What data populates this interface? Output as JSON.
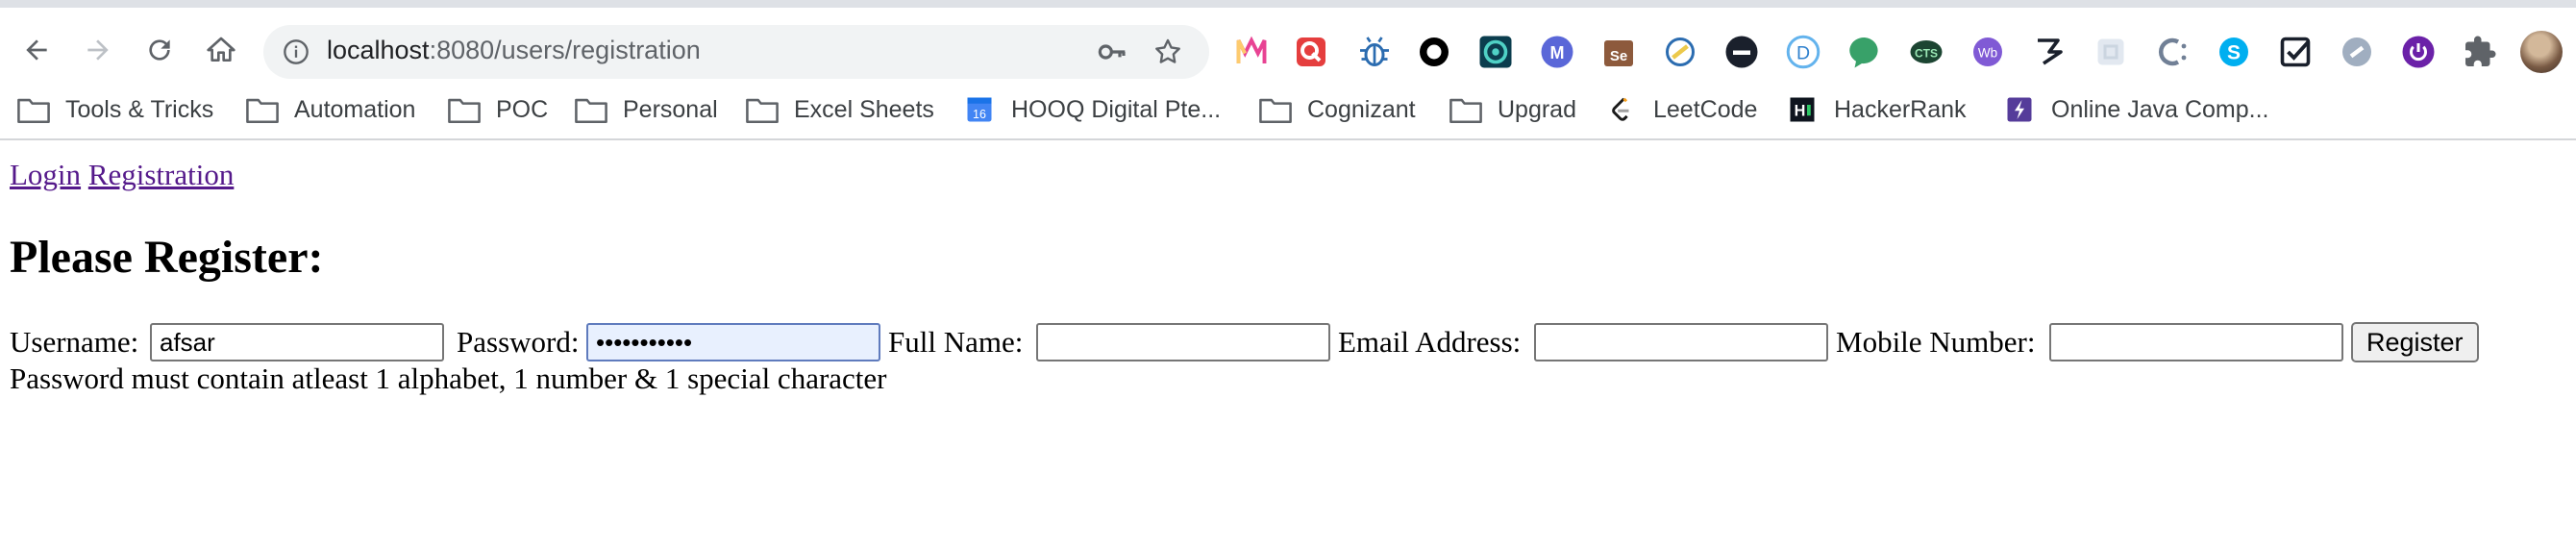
{
  "browser": {
    "url_host": "localhost",
    "url_rest": ":8080/users/registration",
    "extensions": [
      "m-icon",
      "quick-icon",
      "bug-icon",
      "circle-icon",
      "target-icon",
      "m-circle-icon",
      "selenium-icon",
      "chromium-icon",
      "minus-circle-icon",
      "d-icon",
      "chat-icon",
      "cts-icon",
      "wb-icon",
      "hook-icon",
      "tile-icon",
      "c-icon",
      "skype-icon",
      "check-icon",
      "link-icon",
      "power-icon",
      "puzzle-icon"
    ]
  },
  "bookmarks": [
    {
      "label": "Tools & Tricks",
      "icon": "folder-icon"
    },
    {
      "label": "Automation",
      "icon": "folder-icon"
    },
    {
      "label": "POC",
      "icon": "folder-icon"
    },
    {
      "label": "Personal",
      "icon": "folder-icon"
    },
    {
      "label": "Excel Sheets",
      "icon": "folder-icon"
    },
    {
      "label": "HOOQ Digital Pte...",
      "icon": "calendar-icon",
      "icon_text": "16"
    },
    {
      "label": "Cognizant",
      "icon": "folder-icon"
    },
    {
      "label": "Upgrad",
      "icon": "folder-icon"
    },
    {
      "label": "LeetCode",
      "icon": "leetcode-icon"
    },
    {
      "label": "HackerRank",
      "icon": "hackerrank-icon",
      "icon_text": "H"
    },
    {
      "label": "Online Java Comp...",
      "icon": "lightning-icon"
    }
  ],
  "page": {
    "links": {
      "login": "Login",
      "registration": "Registration"
    },
    "title": "Please Register:",
    "form": {
      "username_label": "Username:",
      "username_value": "afsar",
      "password_label": "Password:",
      "password_value": "•••••••••••",
      "fullname_label": "Full Name:",
      "fullname_value": "",
      "email_label": "Email Address:",
      "email_value": "",
      "mobile_label": "Mobile Number:",
      "mobile_value": "",
      "register_button": "Register"
    },
    "hint": "Password must contain atleast 1 alphabet, 1 number & 1 special character"
  },
  "colors": {
    "link": "#551a8b",
    "focused_field": "#e8f0fe",
    "chrome_bg": "#f1f3f4"
  }
}
